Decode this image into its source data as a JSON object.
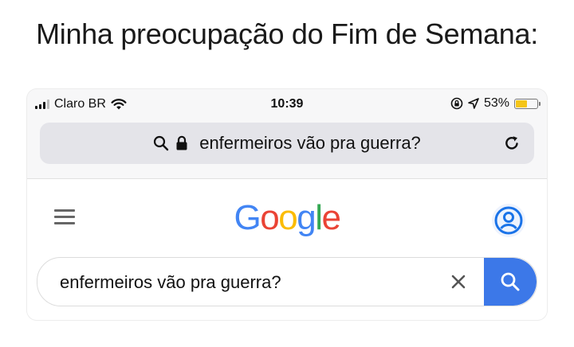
{
  "caption": "Minha preocupação do Fim de Semana:",
  "status_bar": {
    "carrier": "Claro BR",
    "time": "10:39",
    "battery_percent": "53%",
    "battery_level": 0.53,
    "icons": [
      "signal-icon",
      "wifi-icon",
      "orientation-lock-icon",
      "location-arrow-icon",
      "battery-icon"
    ]
  },
  "url_bar": {
    "text": "enfermeiros vão pra guerra?",
    "icons": [
      "search-icon",
      "lock-icon",
      "reload-icon"
    ]
  },
  "google_page": {
    "logo_letters": [
      {
        "char": "G",
        "color": "#4285F4"
      },
      {
        "char": "o",
        "color": "#EA4335"
      },
      {
        "char": "o",
        "color": "#FBBC05"
      },
      {
        "char": "g",
        "color": "#4285F4"
      },
      {
        "char": "l",
        "color": "#34A853"
      },
      {
        "char": "e",
        "color": "#EA4335"
      }
    ],
    "search_value": "enfermeiros vão pra guerra?",
    "accent_color": "#3c78e8",
    "icons": [
      "menu-icon",
      "account-icon",
      "clear-icon",
      "search-icon"
    ]
  }
}
